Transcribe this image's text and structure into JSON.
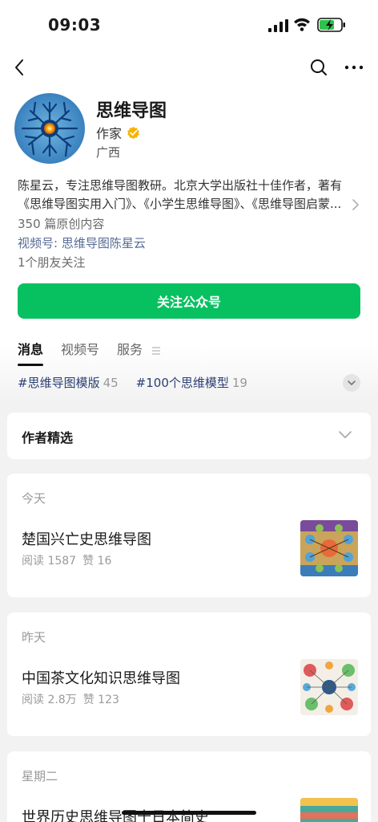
{
  "status_bar": {
    "time": "09:03"
  },
  "profile": {
    "name": "思维导图",
    "type": "作家",
    "region": "广西",
    "bio": "陈星云，专注思维导图教研。北京大学出版社十佳作者，著有《思维导图实用入门》、《小学生思维导图》、《思维导图启蒙...",
    "original_count": "350 篇原创内容",
    "channel": "视频号: 思维导图陈星云",
    "friends": "1个朋友关注"
  },
  "follow_button": "关注公众号",
  "tabs": [
    {
      "label": "消息"
    },
    {
      "label": "视频号"
    },
    {
      "label": "服务"
    }
  ],
  "tags": [
    {
      "name": "#思维导图模版",
      "count": "45"
    },
    {
      "name": "#100个思维模型",
      "count": "19"
    }
  ],
  "author_picks": "作者精选",
  "articles": [
    {
      "day": "今天",
      "title": "楚国兴亡史思维导图",
      "reads": "阅读 1587",
      "likes": "赞 16"
    },
    {
      "day": "昨天",
      "title": "中国茶文化知识思维导图",
      "reads": "阅读 2.8万",
      "likes": "赞 123"
    },
    {
      "day": "星期二",
      "title": "世界历史思维导图十日本简史"
    }
  ],
  "colors": {
    "accent": "#07c160",
    "link": "#576b95",
    "tag": "#2a3f73",
    "verified": "#f5b400"
  }
}
